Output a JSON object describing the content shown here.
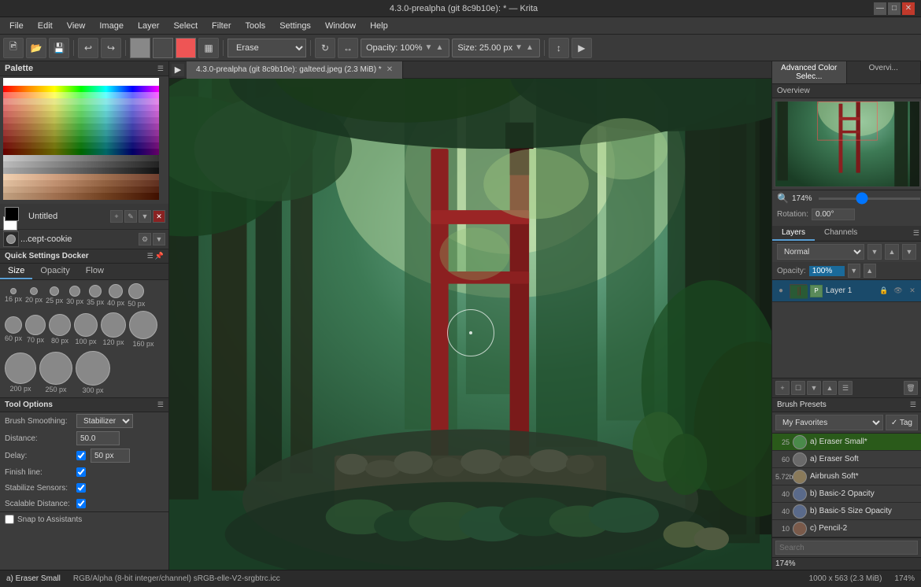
{
  "titlebar": {
    "title": "4.3.0-prealpha (git 8c9b10e): * — Krita",
    "minimize_label": "—",
    "maximize_label": "□",
    "close_label": "✕"
  },
  "menubar": {
    "items": [
      "File",
      "Edit",
      "View",
      "Image",
      "Layer",
      "Select",
      "Filter",
      "Tools",
      "Settings",
      "Window",
      "Help"
    ]
  },
  "toolbar": {
    "brush_mode": "Erase",
    "opacity_label": "Opacity: 100%",
    "size_label": "Size: 25.00 px"
  },
  "document_tab": {
    "label": "4.3.0-prealpha (git 8c9b10e): galteed.jpeg (2.3 MiB) *"
  },
  "left_panel": {
    "palette_title": "Palette",
    "layer_name": "Untitled",
    "brush_name": "...cept-cookie",
    "quick_settings_title": "Quick Settings Docker",
    "qs_tabs": [
      "Size",
      "Opacity",
      "Flow"
    ],
    "brush_sizes": [
      {
        "px": "16 px",
        "size": 8
      },
      {
        "px": "20 px",
        "size": 10
      },
      {
        "px": "25 px",
        "size": 12
      },
      {
        "px": "30 px",
        "size": 14
      },
      {
        "px": "35 px",
        "size": 16
      },
      {
        "px": "40 px",
        "size": 18
      },
      {
        "px": "50 px",
        "size": 20
      },
      {
        "px": "60 px",
        "size": 22
      },
      {
        "px": "70 px",
        "size": 26
      },
      {
        "px": "80 px",
        "size": 28
      },
      {
        "px": "100 px",
        "size": 30
      },
      {
        "px": "120 px",
        "size": 32
      },
      {
        "px": "160 px",
        "size": 36
      },
      {
        "px": "200 px",
        "size": 40
      },
      {
        "px": "250 px",
        "size": 44
      },
      {
        "px": "300 px",
        "size": 48
      }
    ],
    "tool_options_title": "Tool Options",
    "brush_smoothing_label": "Brush Smoothing:",
    "brush_smoothing_value": "Stabilizer",
    "distance_label": "Distance:",
    "distance_value": "50.0",
    "delay_label": "Delay:",
    "delay_value": "50 px",
    "finish_line_label": "Finish line:",
    "stabilize_sensors_label": "Stabilize Sensors:",
    "scalable_distance_label": "Scalable Distance:",
    "snap_label": "Snap to Assistants"
  },
  "right_panel": {
    "top_tabs": [
      "Advanced Color Selec...",
      "Overvi..."
    ],
    "zoom_value": "174%",
    "rotation_label": "Rotation:",
    "rotation_value": "0.00°",
    "layers_tabs": [
      "Layers",
      "Channels"
    ],
    "blend_mode": "Normal",
    "opacity_label": "Opacity:",
    "opacity_value": "100%",
    "layers": [
      {
        "name": "Layer 1",
        "selected": true
      }
    ],
    "brush_presets_title": "Brush Presets",
    "bp_folder": "My Favorites",
    "bp_tag_label": "Tag",
    "bp_items": [
      {
        "num": "25",
        "name": "a) Eraser Small*",
        "selected": true,
        "color": "#4a8a4a"
      },
      {
        "num": "60",
        "name": "a) Eraser Soft",
        "selected": false,
        "color": "#6a6a6a"
      },
      {
        "num": "5.72b",
        "name": "Airbrush Soft*",
        "selected": false,
        "color": "#8a7a5a"
      },
      {
        "num": "40",
        "name": "b) Basic-2 Opacity",
        "selected": false,
        "color": "#5a6a8a"
      },
      {
        "num": "40",
        "name": "b) Basic-5 Size Opacity",
        "selected": false,
        "color": "#5a6a8a"
      },
      {
        "num": "10",
        "name": "c) Pencil-2",
        "selected": false,
        "color": "#7a5a4a"
      }
    ],
    "search_placeholder": "Search"
  },
  "statusbar": {
    "tool_name": "a) Eraser Small",
    "color_info": "RGB/Alpha (8-bit integer/channel)  sRGB-elle-V2-srgbtrc.icc",
    "dimensions": "1000 x 563 (2.3 MiB)",
    "zoom": "174%"
  }
}
